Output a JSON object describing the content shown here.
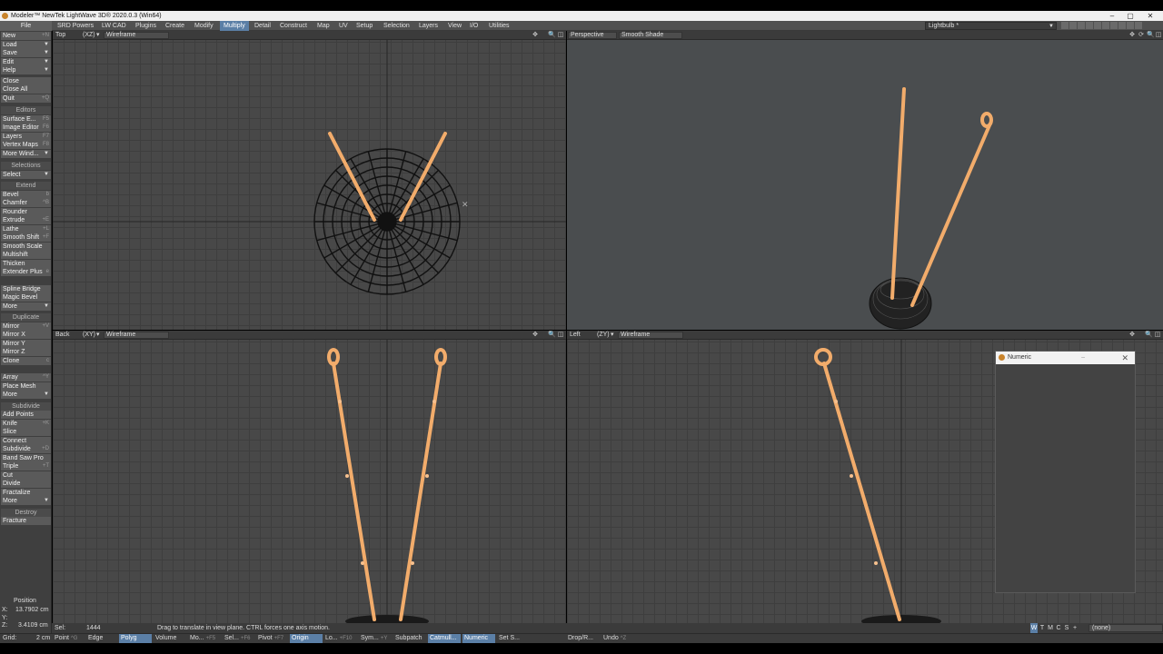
{
  "window": {
    "title": "Modeler™ NewTek LightWave 3D® 2020.0.3 (Win64)",
    "minimize": "–",
    "maximize": "▢",
    "close": "✕"
  },
  "menubar": {
    "file": "File",
    "tabs": [
      "SRD Powers",
      "LW CAD",
      "Plugins",
      "Create",
      "Modify",
      "Multiply",
      "Detail",
      "Construct",
      "Map",
      "UV",
      "Setup",
      "Selection",
      "Layers",
      "View",
      "I/O",
      "Utilities"
    ],
    "active_tab": "Multiply",
    "object": "Lightbulb *"
  },
  "sidebar": {
    "file_items": [
      "New",
      "Load",
      "Save",
      "Edit",
      "Help"
    ],
    "file_shortcuts": [
      "+N",
      "",
      "",
      "",
      ""
    ],
    "close_items": [
      "Close",
      "Close All",
      "Quit"
    ],
    "close_shortcuts": [
      "",
      "",
      "+Q"
    ],
    "editors_head": "Editors",
    "editors": [
      "Surface E...",
      "Image Editor",
      "Layers",
      "Vertex Maps",
      "More Wind..."
    ],
    "editors_shortcuts": [
      "F5",
      "F6",
      "F7",
      "F8",
      ""
    ],
    "selections_head": "Selections",
    "select": "Select",
    "extend_head": "Extend",
    "extend": [
      "Bevel",
      "Chamfer",
      "Rounder",
      "Extrude",
      "Lathe",
      "Smooth Shift",
      "Smooth Scale",
      "Multishift",
      "Thicken",
      "Extender Plus"
    ],
    "extend_shortcuts": [
      "b",
      "^B",
      "",
      "+E",
      "+L",
      "+F",
      "",
      "",
      "",
      "e"
    ],
    "spline": [
      "Spline Bridge",
      "Magic Bevel",
      "More"
    ],
    "duplicate_head": "Duplicate",
    "duplicate": [
      "Mirror",
      "Mirror X",
      "Mirror Y",
      "Mirror Z",
      "Clone"
    ],
    "duplicate_shortcuts": [
      "+V",
      "",
      "",
      "",
      "c"
    ],
    "array": [
      "Array",
      "Place Mesh",
      "More"
    ],
    "array_shortcuts": [
      "^Y",
      "",
      ""
    ],
    "subdivide_head": "Subdivide",
    "subdivide": [
      "Add Points",
      "Knife",
      "Slice",
      "Connect",
      "Subdivide",
      "Band Saw Pro",
      "Triple",
      "Cut",
      "Divide",
      "Fractalize",
      "More"
    ],
    "subdivide_shortcuts": [
      "",
      "+K",
      "",
      "",
      "+D",
      "",
      "+T",
      "",
      "",
      "",
      ""
    ],
    "destroy_head": "Destroy",
    "destroy": [
      "Fracture"
    ]
  },
  "position": {
    "title": "Position",
    "x_label": "X:",
    "x": "13.7902 cm",
    "y_label": "Y:",
    "y": "",
    "z_label": "Z:",
    "z": "3.4109 cm"
  },
  "viewports": {
    "top": {
      "view": "Top",
      "axis": "(XZ)",
      "mode": "Wireframe"
    },
    "perspective": {
      "view": "Perspective",
      "mode": "Smooth Shade"
    },
    "back": {
      "view": "Back",
      "axis": "(XY)",
      "mode": "Wireframe"
    },
    "left": {
      "view": "Left",
      "axis": "(ZY)",
      "mode": "Wireframe"
    }
  },
  "numeric_panel": {
    "title": "Numeric"
  },
  "status": {
    "sel_label": "Sel:",
    "sel_value": "1444",
    "message": "Drag to translate in view plane. CTRL forces one axis motion.",
    "modes": [
      "W",
      "T",
      "M",
      "C",
      "S",
      "+"
    ],
    "active_mode": "W",
    "none_value": "(none)"
  },
  "toolbar": {
    "grid_label": "Grid:",
    "grid_value": "2 cm",
    "point": "Point",
    "point_sc": "^G",
    "edge": "Edge",
    "polygon": "Polyg",
    "volume": "Volume",
    "mo": "Mo...",
    "mo_sc": "+F5",
    "sel": "Sel...",
    "sel_sc": "+F6",
    "pivot": "Pivot",
    "pivot_sc": "+F7",
    "origin": "Origin",
    "lo": "Lo...",
    "lo_sc": "+F10",
    "sym": "Sym...",
    "sym_sc": "+Y",
    "subpatch": "Subpatch",
    "catmull": "Catmull...",
    "numeric": "Numeric",
    "sets": "Set S...",
    "drop": "Drop/R...",
    "undo": "Undo",
    "undo_sc": "^Z"
  },
  "colors": {
    "accent": "#5b7fa6",
    "filament": "#f2ac6b",
    "wire": "#141414"
  }
}
